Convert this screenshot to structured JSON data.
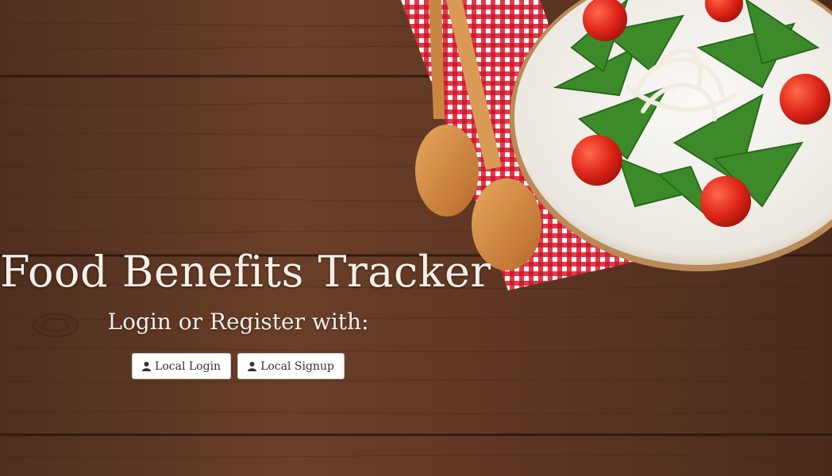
{
  "header": {
    "title": "Food Benefits Tracker",
    "subtitle": "Login or Register with:"
  },
  "actions": {
    "local_login_label": "Local Login",
    "local_signup_label": "Local Signup",
    "login_icon": "user-icon",
    "signup_icon": "user-icon"
  },
  "background": {
    "description_icon": "wood-table-salad-photo",
    "colors": {
      "wood_dark": "#4a2c1c",
      "wood_mid": "#6b3f28",
      "napkin_red": "#d9253a",
      "plate_white": "#f2f0ec",
      "spoon_wood": "#d9954a",
      "arugula_green": "#3a8a2a",
      "tomato_red": "#e02a1a"
    }
  }
}
